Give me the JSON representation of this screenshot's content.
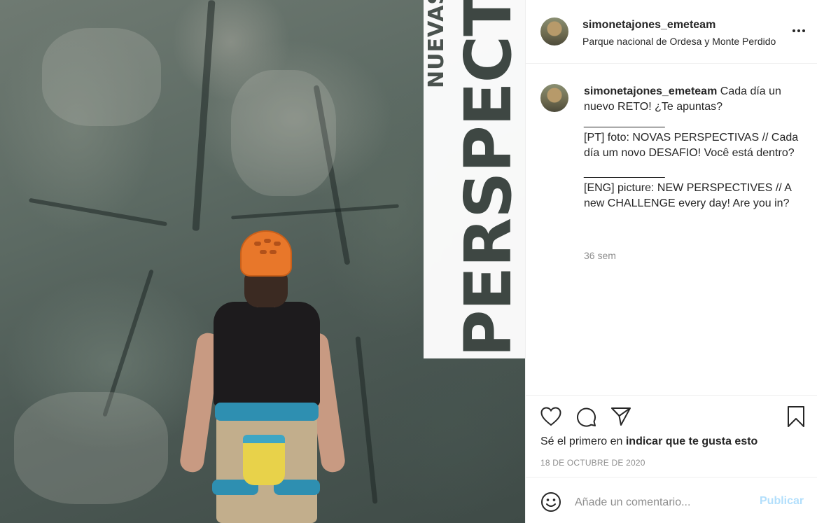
{
  "post": {
    "image": {
      "overlay_small": "NUEVAS",
      "overlay_big": "PERSPECTIVAS"
    }
  },
  "header": {
    "username": "simonetajones_emeteam",
    "location": "Parque nacional de Ordesa y Monte Perdido",
    "more_icon": "ellipsis-icon"
  },
  "caption": {
    "username": "simonetajones_emeteam",
    "line1": "Cada día un nuevo RETO! ¿Te apuntas?",
    "separator1": "_____________",
    "line2": "[PT] foto: NOVAS PERSPECTIVAS // Cada día um novo DESAFIO! Você está dentro?",
    "separator2": "_____________",
    "line3": "[ENG] picture: NEW PERSPECTIVES // A new CHALLENGE every day! Are you in?",
    "time_ago": "36 sem"
  },
  "actions": {
    "like_icon": "heart-icon",
    "comment_icon": "comment-icon",
    "share_icon": "paper-plane-icon",
    "save_icon": "bookmark-icon"
  },
  "likes": {
    "prefix": "Sé el primero en ",
    "link": "indicar que te gusta esto"
  },
  "date": "18 DE OCTUBRE DE 2020",
  "comment": {
    "emoji_icon": "smiley-icon",
    "placeholder": "Añade un comentario...",
    "value": "",
    "publish_label": "Publicar"
  },
  "colors": {
    "text": "#262626",
    "secondary": "#8e8e8e",
    "publish_disabled": "#b2dffc",
    "divider": "#efefef"
  }
}
